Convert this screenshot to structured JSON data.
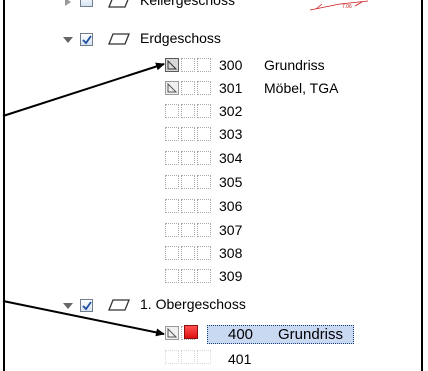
{
  "floors": {
    "keller": {
      "label": "Kellergeschoss"
    },
    "eg": {
      "label": "Erdgeschoss"
    },
    "og": {
      "label": "1. Obergeschoss"
    }
  },
  "eg_items": [
    {
      "number": "300",
      "name": "Grundriss"
    },
    {
      "number": "301",
      "name": "Möbel, TGA"
    },
    {
      "number": "302",
      "name": ""
    },
    {
      "number": "303",
      "name": ""
    },
    {
      "number": "304",
      "name": ""
    },
    {
      "number": "305",
      "name": ""
    },
    {
      "number": "306",
      "name": ""
    },
    {
      "number": "307",
      "name": ""
    },
    {
      "number": "308",
      "name": ""
    },
    {
      "number": "309",
      "name": ""
    }
  ],
  "og_items": [
    {
      "number": "400",
      "name": "Grundriss"
    },
    {
      "number": "401",
      "name": ""
    }
  ],
  "drawing_label": "7.06",
  "colors": {
    "selection": "#c9d9f2",
    "marker_red": "#e01010",
    "drawing_red": "#cc1a1a"
  }
}
